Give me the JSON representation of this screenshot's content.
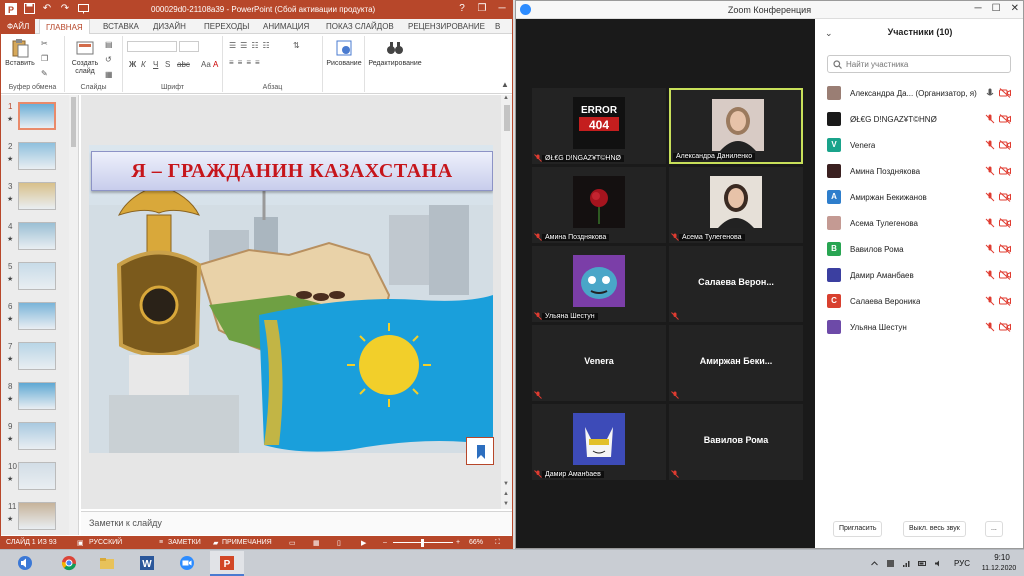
{
  "ppt": {
    "doc_title": "000029d0-21108a39  -  PowerPoint (Сбой активации продукта)",
    "qa_save": "save-icon",
    "qa_undo": "↶",
    "qa_redo": "↷",
    "qa_present": "start-presentation-icon",
    "win_help": "?",
    "win_min": "─",
    "win_restore": "❐",
    "tabs": {
      "file": "ФАЙЛ",
      "home": "ГЛАВНАЯ",
      "insert": "ВСТАВКА",
      "design": "ДИЗАЙН",
      "transitions": "ПЕРЕХОДЫ",
      "animations": "АНИМАЦИЯ",
      "slideshow": "ПОКАЗ СЛАЙДОВ",
      "review": "РЕЦЕНЗИРОВАНИЕ",
      "more": "В"
    },
    "ribbon": {
      "paste": "Вставить",
      "clipboard": "Буфер обмена",
      "new_slide_1": "Создать",
      "new_slide_2": "слайд",
      "slides": "Слайды",
      "font": "Шрифт",
      "paragraph": "Абзац",
      "drawing": "Рисование",
      "editing": "Редактирование",
      "bold": "Ж",
      "italic": "К",
      "underline": "Ч",
      "strike": "S",
      "shadow": "abc",
      "font_color": "А",
      "font_size": "Aa"
    },
    "thumbs": [
      "1",
      "2",
      "3",
      "4",
      "5",
      "6",
      "7",
      "8",
      "9",
      "10",
      "11"
    ],
    "thumb_star": "★",
    "slide_title": "Я – ГРАЖДАНИН  КАЗАХСТАНА",
    "notes": "Заметки к слайду",
    "status": {
      "slide": "СЛАЙД 1 ИЗ 93",
      "lang": "РУССКИЙ",
      "notes": "ЗАМЕТКИ",
      "comments": "ПРИМЕЧАНИЯ",
      "zoom_minus": "–",
      "zoom_plus": "+",
      "zoom": "66%"
    },
    "colors": {
      "accent": "#b7472a",
      "slide_title": "#c6151b"
    }
  },
  "zoom": {
    "title": "Zoom Конференция",
    "win_min": "─",
    "win_max": "☐",
    "win_close": "✕",
    "tiles": [
      {
        "name": "ØŁ€G D!NGAZ¥T©HNØ",
        "video": "error-404",
        "error_1": "ERROR",
        "error_2": "404"
      },
      {
        "name": "Александра Даниленко",
        "video": "woman-photo",
        "speaking": true
      },
      {
        "name": "Амина Позднякова",
        "video": "rose"
      },
      {
        "name": "Асема Тулегенова",
        "video": "girl-photo"
      },
      {
        "name": "Ульяна Шестун",
        "video": "cartoon-face"
      },
      {
        "name": "Салаева  Верон...",
        "video": "none"
      },
      {
        "name": "Venera",
        "video": "none"
      },
      {
        "name": "Амиржан  Беки...",
        "video": "none"
      },
      {
        "name": "Дамир Аманбаев",
        "video": "cartoon-cat"
      },
      {
        "name": "Вавилов Рома",
        "video": "none"
      }
    ],
    "panel": {
      "header": "Участники (10)",
      "search_placeholder": "Найти участника",
      "participants": [
        {
          "name": "Александра Да... (Организатор, я)",
          "avatar": "photo",
          "color": "#9a7e74",
          "letter": ""
        },
        {
          "name": "ØŁ€G D!NGAZ¥T©HNØ",
          "avatar": "error-404",
          "color": "#1a1a1a",
          "letter": ""
        },
        {
          "name": "Venera",
          "avatar": "letter",
          "color": "#1aa38b",
          "letter": "V"
        },
        {
          "name": "Амина Позднякова",
          "avatar": "rose",
          "color": "#3a2020",
          "letter": ""
        },
        {
          "name": "Амиржан Бекижанов",
          "avatar": "letter",
          "color": "#2e7ecc",
          "letter": "A"
        },
        {
          "name": "Асема Тулегенова",
          "avatar": "photo",
          "color": "#c49a93",
          "letter": ""
        },
        {
          "name": "Вавилов Рома",
          "avatar": "letter",
          "color": "#28a552",
          "letter": "B"
        },
        {
          "name": "Дамир Аманбаев",
          "avatar": "cartoon",
          "color": "#3b3fa0",
          "letter": ""
        },
        {
          "name": "Салаева Вероника",
          "avatar": "letter",
          "color": "#d8402f",
          "letter": "C"
        },
        {
          "name": "Ульяна Шестун",
          "avatar": "cartoon",
          "color": "#6d4aa8",
          "letter": ""
        }
      ],
      "invite": "Пригласить",
      "mute_all": "Выкл. весь звук",
      "more": "..."
    },
    "colors": {
      "speaking": "#c8e05a",
      "muted": "#e03c31",
      "brand": "#2d8cff"
    }
  },
  "taskbar": {
    "apps": [
      "speaker",
      "chrome",
      "explorer",
      "word",
      "zoom",
      "powerpoint"
    ],
    "active": "powerpoint",
    "lang": "РУС",
    "time": "9:10",
    "date": "11.12.2020"
  }
}
